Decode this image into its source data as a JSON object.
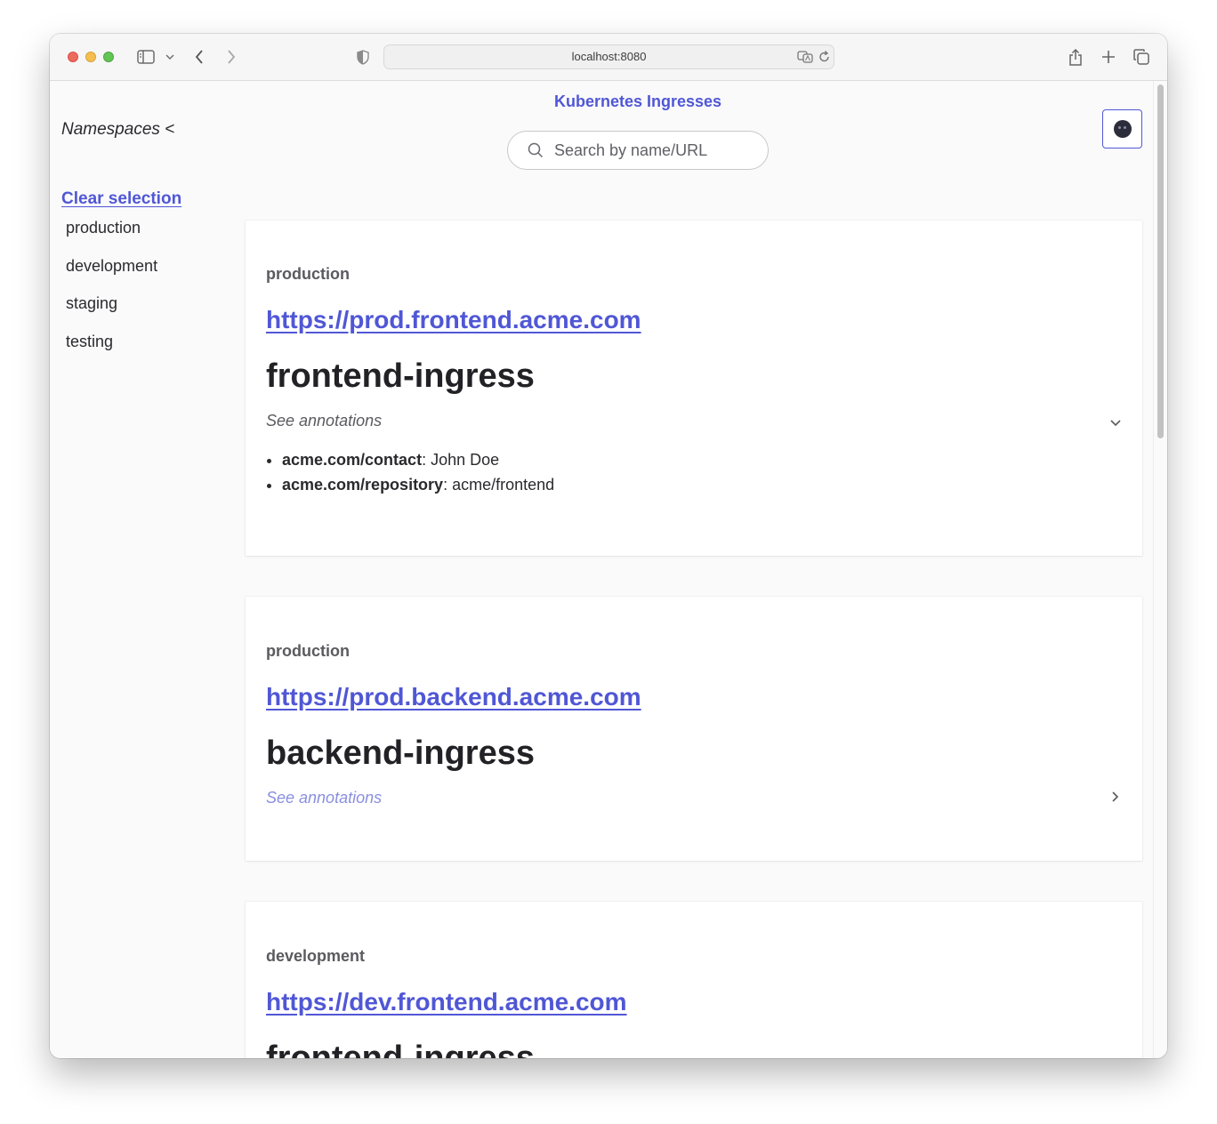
{
  "browser": {
    "url": "localhost:8080"
  },
  "app": {
    "title": "Kubernetes Ingresses"
  },
  "sidebar": {
    "toggle_label": "Namespaces <",
    "clear_label": "Clear selection",
    "namespaces": [
      "production",
      "development",
      "staging",
      "testing"
    ]
  },
  "search": {
    "placeholder": "Search by name/URL",
    "value": ""
  },
  "colors": {
    "accent": "#5057d5",
    "text": "#222226",
    "muted": "#5a5a60",
    "annotation_collapsed": "#8a8fe0"
  },
  "cards": [
    {
      "namespace": "production",
      "url": "https://prod.frontend.acme.com",
      "name": "frontend-ingress",
      "annotations_label": "See annotations",
      "expanded": true,
      "annotations": [
        {
          "key": "acme.com/contact",
          "value": ": John Doe"
        },
        {
          "key": "acme.com/repository",
          "value": ": acme/frontend"
        }
      ]
    },
    {
      "namespace": "production",
      "url": "https://prod.backend.acme.com",
      "name": "backend-ingress",
      "annotations_label": "See annotations",
      "expanded": false,
      "annotations": []
    },
    {
      "namespace": "development",
      "url": "https://dev.frontend.acme.com",
      "name": "frontend-ingress"
    }
  ]
}
